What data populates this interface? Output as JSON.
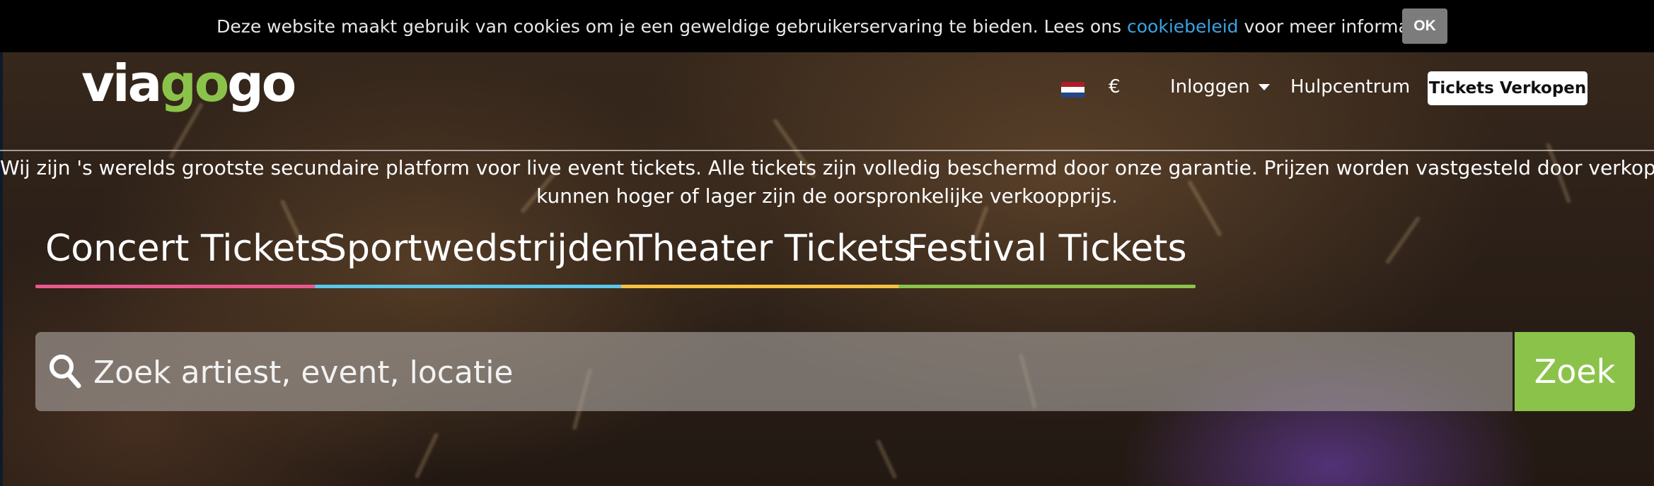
{
  "cookie": {
    "text_before": "Deze website maakt gebruik van cookies om je een geweldige gebruikerservaring te bieden. Lees ons ",
    "link": "cookiebeleid",
    "text_after": " voor meer informatie.",
    "ok": "OK"
  },
  "header": {
    "logo": {
      "part1": "via",
      "part2": "go",
      "part3": "go"
    },
    "currency": "€",
    "login": "Inloggen",
    "help": "Hulpcentrum",
    "sell": "Tickets Verkopen"
  },
  "tagline": {
    "line1": "Wij zijn 's werelds grootste secundaire platform voor live event tickets. Alle tickets zijn volledig beschermd door onze garantie. Prijzen worden vastgesteld door verkopers en",
    "line2": "kunnen hoger of lager zijn de oorspronkelijke verkoopprijs."
  },
  "categories": [
    {
      "label": "Concert Tickets",
      "color": "#e8588e"
    },
    {
      "label": "Sportwedstrijden",
      "color": "#5bc6ea"
    },
    {
      "label": "Theater Tickets",
      "color": "#f5c242"
    },
    {
      "label": "Festival Tickets",
      "color": "#8bc34a"
    }
  ],
  "search": {
    "placeholder": "Zoek artiest, event, locatie",
    "button": "Zoek",
    "icon": "search-icon"
  },
  "colors": {
    "brand_green": "#8bc34a",
    "link_blue": "#3aa3e3",
    "ok_gray": "#7c7c7c"
  }
}
